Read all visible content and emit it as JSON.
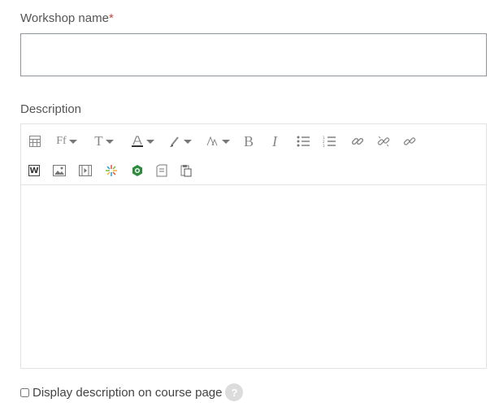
{
  "form": {
    "name_label": "Workshop name",
    "required_mark": "*",
    "name_value": "",
    "description_label": "Description",
    "display_label": "Display description on course page",
    "help_glyph": "?"
  },
  "toolbar": {
    "row1": [
      "toggle-toolbar-icon",
      "font-family-icon",
      "font-size-icon",
      "text-color-icon",
      "background-color-icon",
      "font-style-icon",
      "bold-icon",
      "italic-icon",
      "unordered-list-icon",
      "ordered-list-icon",
      "link-icon",
      "unlink-icon",
      "anchor-icon"
    ],
    "row2": [
      "word-paste-icon",
      "image-icon",
      "media-icon",
      "kaltura-icon",
      "recording-icon",
      "file-icon",
      "paste-icon"
    ],
    "font_family_glyph": "Ff",
    "font_size_glyph": "T",
    "bold_glyph": "B",
    "italic_glyph": "I",
    "word_glyph": "W"
  },
  "colors": {
    "accent_required": "#b94a48",
    "border": "#8f959e",
    "toolbar_icon": "#888888"
  }
}
